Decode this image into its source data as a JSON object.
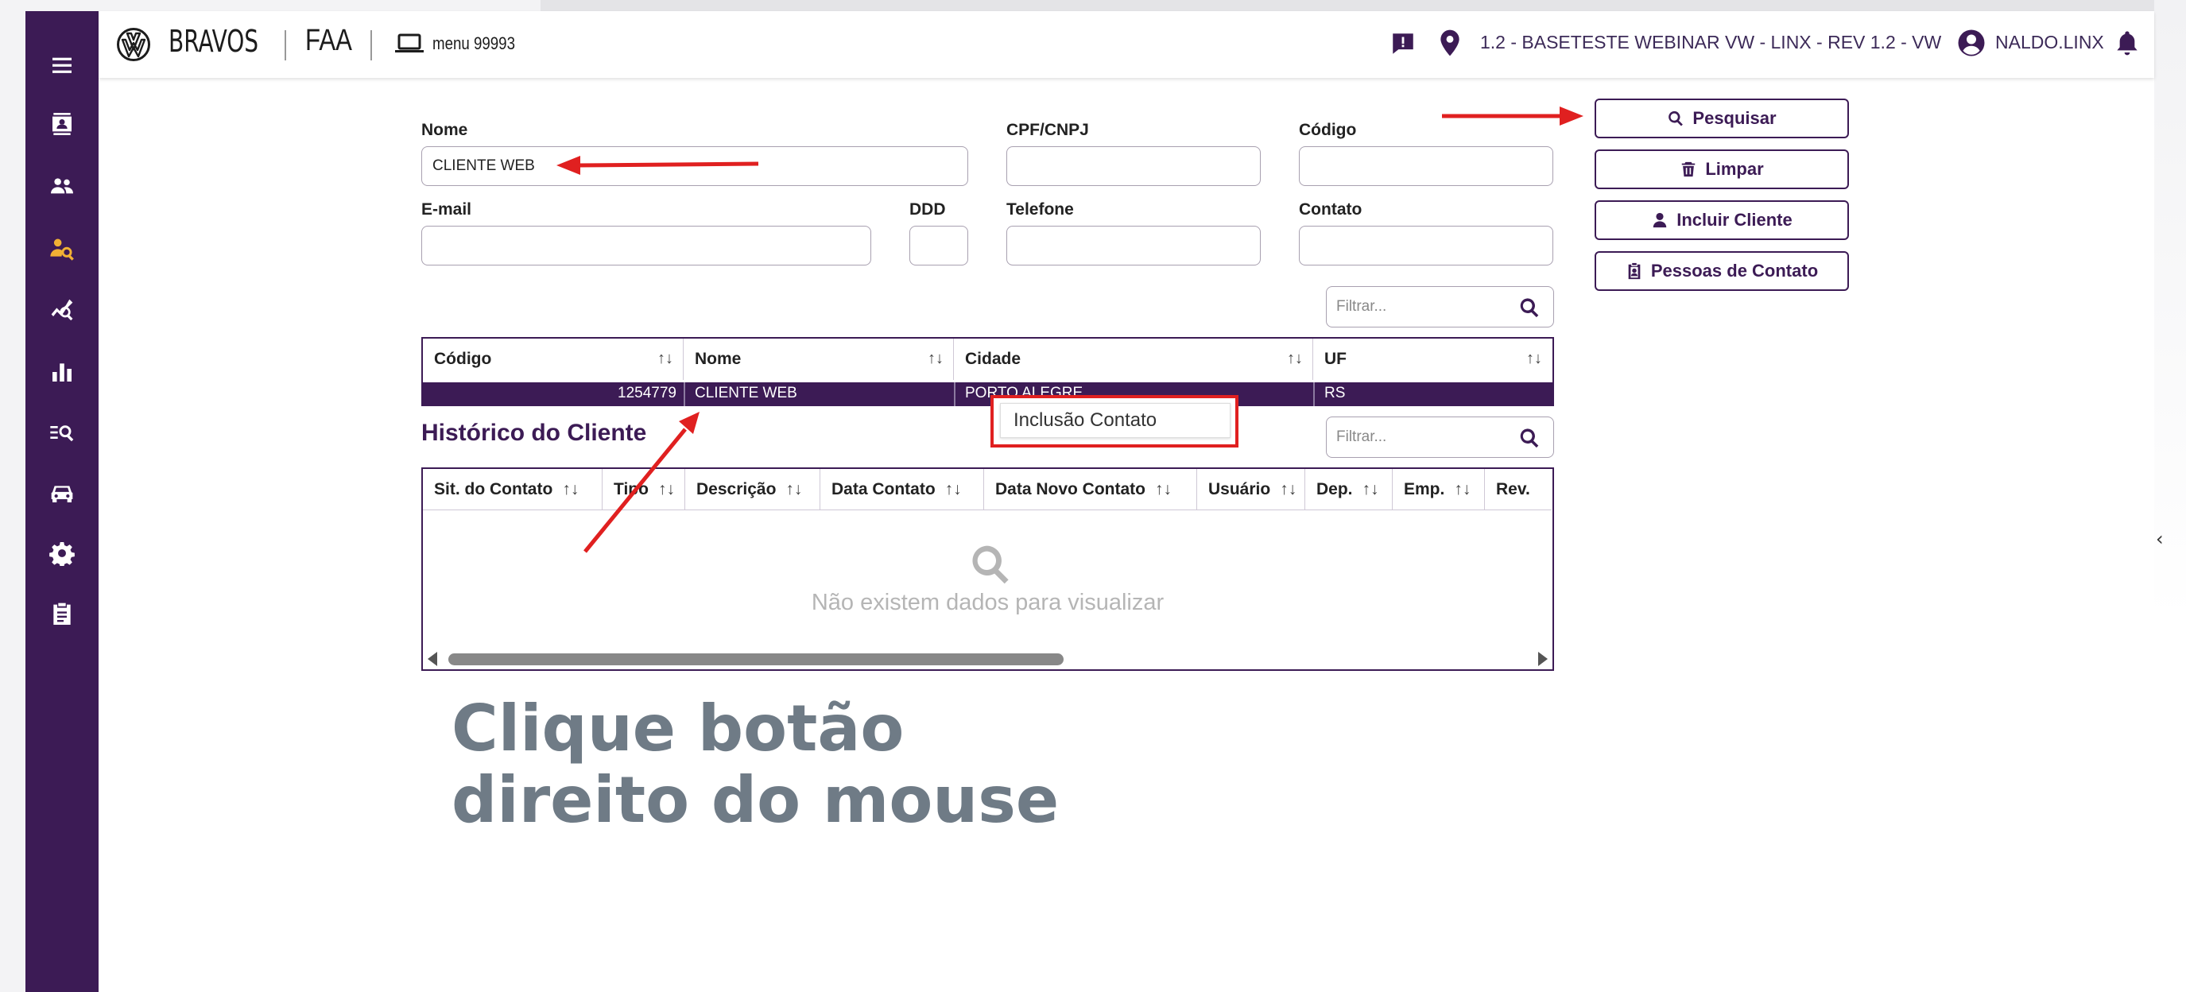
{
  "header": {
    "brand": "BRAVOS",
    "module": "FAA",
    "menu": "menu 99993",
    "location": "1.2 - BASETESTE WEBINAR VW - LINX - REV 1.2 - VW",
    "user": "NALDO.LINX"
  },
  "sidebar": {
    "items": [
      {
        "icon": "menu-icon"
      },
      {
        "icon": "contact-card-icon"
      },
      {
        "icon": "users-icon"
      },
      {
        "icon": "user-search-icon",
        "active": true
      },
      {
        "icon": "analytics-icon"
      },
      {
        "icon": "bar-chart-icon"
      },
      {
        "icon": "list-search-icon"
      },
      {
        "icon": "car-icon"
      },
      {
        "icon": "gear-icon"
      },
      {
        "icon": "clipboard-icon"
      }
    ]
  },
  "form": {
    "nome_label": "Nome",
    "nome_value": "CLIENTE WEB",
    "cpf_label": "CPF/CNPJ",
    "cpf_value": "",
    "codigo_label": "Código",
    "codigo_value": "",
    "email_label": "E-mail",
    "email_value": "",
    "ddd_label": "DDD",
    "ddd_value": "",
    "telefone_label": "Telefone",
    "telefone_value": "",
    "contato_label": "Contato",
    "contato_value": ""
  },
  "actions": {
    "pesquisar": "Pesquisar",
    "limpar": "Limpar",
    "incluir_cliente": "Incluir Cliente",
    "pessoas_contato": "Pessoas de Contato"
  },
  "clients_filter_placeholder": "Filtrar...",
  "clients_table": {
    "columns": [
      "Código",
      "Nome",
      "Cidade",
      "UF"
    ],
    "sort_glyph": "↑↓",
    "rows": [
      {
        "codigo": "1254779",
        "nome": "CLIENTE WEB",
        "cidade": "PORTO ALEGRE",
        "uf": "RS"
      }
    ]
  },
  "context_menu": {
    "item": "Inclusão Contato"
  },
  "history": {
    "title": "Histórico do Cliente",
    "filter_placeholder": "Filtrar...",
    "columns": [
      "Sit. do Contato",
      "Tipo",
      "Descrição",
      "Data Contato",
      "Data Novo Contato",
      "Usuário",
      "Dep.",
      "Emp.",
      "Rev."
    ],
    "empty_message": "Não existem dados para visualizar"
  },
  "annotation": {
    "line1": "Clique botão",
    "line2": "direito do mouse",
    "arrow_color": "#e02020"
  },
  "colors": {
    "primary": "#3c1b55",
    "active_icon": "#f2b134",
    "annotation_text": "#6f7b86"
  }
}
